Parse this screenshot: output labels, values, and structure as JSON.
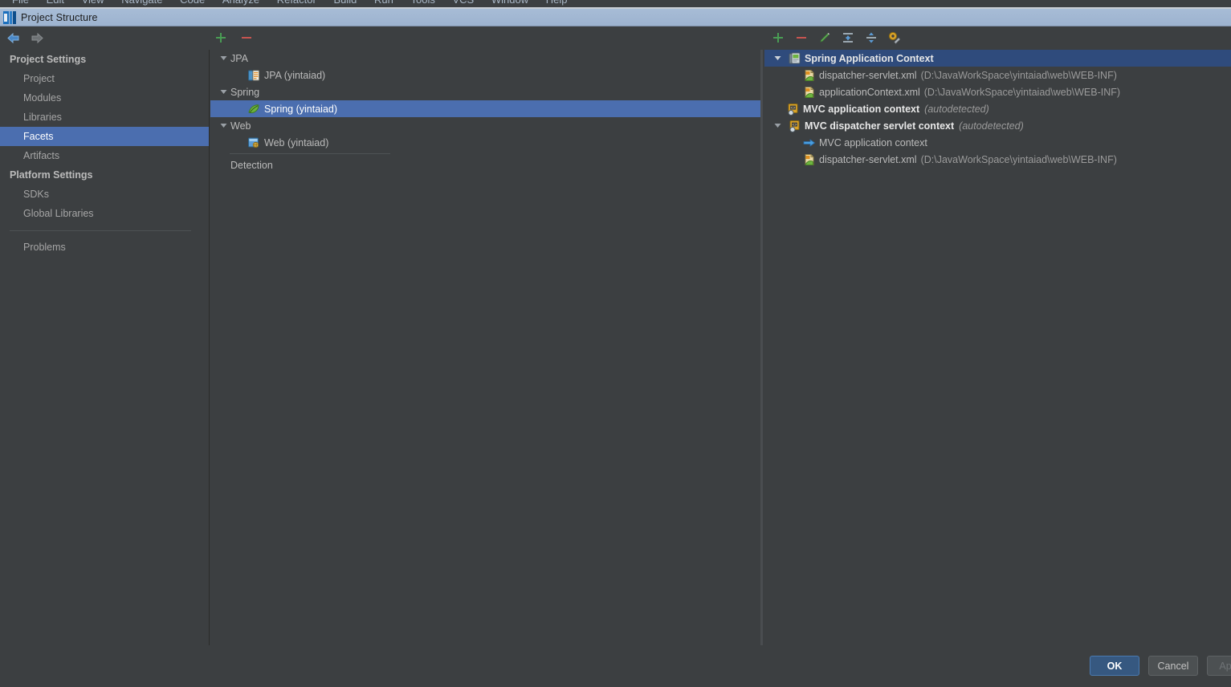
{
  "menubar": {
    "items": [
      "File",
      "Edit",
      "View",
      "Navigate",
      "Code",
      "Analyze",
      "Refactor",
      "Build",
      "Run",
      "Tools",
      "VCS",
      "Window",
      "Help"
    ]
  },
  "window": {
    "title": "Project Structure",
    "logo_icon": "intellij-idea-logo-icon"
  },
  "toolbar": {
    "nav_back_icon": "arrow-left-icon",
    "nav_forward_icon": "arrow-right-icon",
    "mid_add_icon": "plus-icon",
    "mid_remove_icon": "minus-icon",
    "right_add_icon": "plus-icon",
    "right_remove_icon": "minus-icon",
    "right_edit_icon": "pencil-edit-icon",
    "right_collapse_icon": "collapse-all-icon",
    "right_expand_icon": "expand-all-icon",
    "right_settings_icon": "gear-wrench-settings-icon"
  },
  "sidebar": {
    "groups": [
      {
        "label": "Project Settings",
        "items": [
          {
            "label": "Project",
            "selected": false
          },
          {
            "label": "Modules",
            "selected": false
          },
          {
            "label": "Libraries",
            "selected": false
          },
          {
            "label": "Facets",
            "selected": true
          },
          {
            "label": "Artifacts",
            "selected": false
          }
        ]
      },
      {
        "label": "Platform Settings",
        "items": [
          {
            "label": "SDKs",
            "selected": false
          },
          {
            "label": "Global Libraries",
            "selected": false
          }
        ]
      }
    ],
    "footer_items": [
      {
        "label": "Problems",
        "selected": false
      }
    ]
  },
  "facets_tree": {
    "nodes": [
      {
        "label": "JPA",
        "kind": "group",
        "expanded": true,
        "indent": 0,
        "icon": "none",
        "selected": false
      },
      {
        "label": "JPA (yintaiad)",
        "kind": "facet",
        "expanded": null,
        "indent": 1,
        "icon": "jpa-icon",
        "selected": false
      },
      {
        "label": "Spring",
        "kind": "group",
        "expanded": true,
        "indent": 0,
        "icon": "none",
        "selected": false
      },
      {
        "label": "Spring (yintaiad)",
        "kind": "facet",
        "expanded": null,
        "indent": 1,
        "icon": "spring-leaf-icon",
        "selected": true
      },
      {
        "label": "Web",
        "kind": "group",
        "expanded": true,
        "indent": 0,
        "icon": "none",
        "selected": false
      },
      {
        "label": "Web (yintaiad)",
        "kind": "facet",
        "expanded": null,
        "indent": 1,
        "icon": "web-globe-icon",
        "selected": false
      },
      {
        "label": "Detection",
        "kind": "item",
        "expanded": null,
        "indent": 0,
        "icon": "none",
        "selected": false
      }
    ]
  },
  "contexts_tree": {
    "nodes": [
      {
        "name": "Spring Application Context",
        "path": "",
        "annotation": "",
        "bold": true,
        "expanded": true,
        "indent": 0,
        "icon": "spring-context-icon",
        "selected": true
      },
      {
        "name": "dispatcher-servlet.xml",
        "path": "(D:\\JavaWorkSpace\\yintaiad\\web\\WEB-INF)",
        "annotation": "",
        "bold": false,
        "expanded": null,
        "indent": 1,
        "icon": "spring-xml-file-icon",
        "selected": false
      },
      {
        "name": "applicationContext.xml",
        "path": "(D:\\JavaWorkSpace\\yintaiad\\web\\WEB-INF)",
        "annotation": "",
        "bold": false,
        "expanded": null,
        "indent": 1,
        "icon": "spring-xml-file-icon",
        "selected": false
      },
      {
        "name": "MVC application context",
        "path": "",
        "annotation": "(autodetected)",
        "bold": true,
        "expanded": null,
        "indent": 0,
        "icon": "spring-mvc-context-icon",
        "selected": false
      },
      {
        "name": "MVC dispatcher servlet context",
        "path": "",
        "annotation": "(autodetected)",
        "bold": true,
        "expanded": true,
        "indent": 0,
        "icon": "spring-mvc-context-icon",
        "selected": false
      },
      {
        "name": "MVC application context",
        "path": "",
        "annotation": "",
        "bold": false,
        "expanded": null,
        "indent": 1,
        "icon": "blue-arrow-link-icon",
        "selected": false
      },
      {
        "name": "dispatcher-servlet.xml",
        "path": "(D:\\JavaWorkSpace\\yintaiad\\web\\WEB-INF)",
        "annotation": "",
        "bold": false,
        "expanded": null,
        "indent": 1,
        "icon": "spring-xml-file-icon",
        "selected": false
      }
    ]
  },
  "buttons": {
    "ok": "OK",
    "cancel": "Cancel",
    "apply": "Apply"
  },
  "colors": {
    "background": "#3c3f41",
    "selection_blue": "#4b6eaf",
    "selection_dim": "#2f4b7c",
    "titlebar": "#9fb5d0",
    "text": "#bbbbbb",
    "text_dim": "#9b9b9b",
    "accent_green": "#499c54",
    "accent_red": "#c75450",
    "primary_button": "#365880"
  }
}
